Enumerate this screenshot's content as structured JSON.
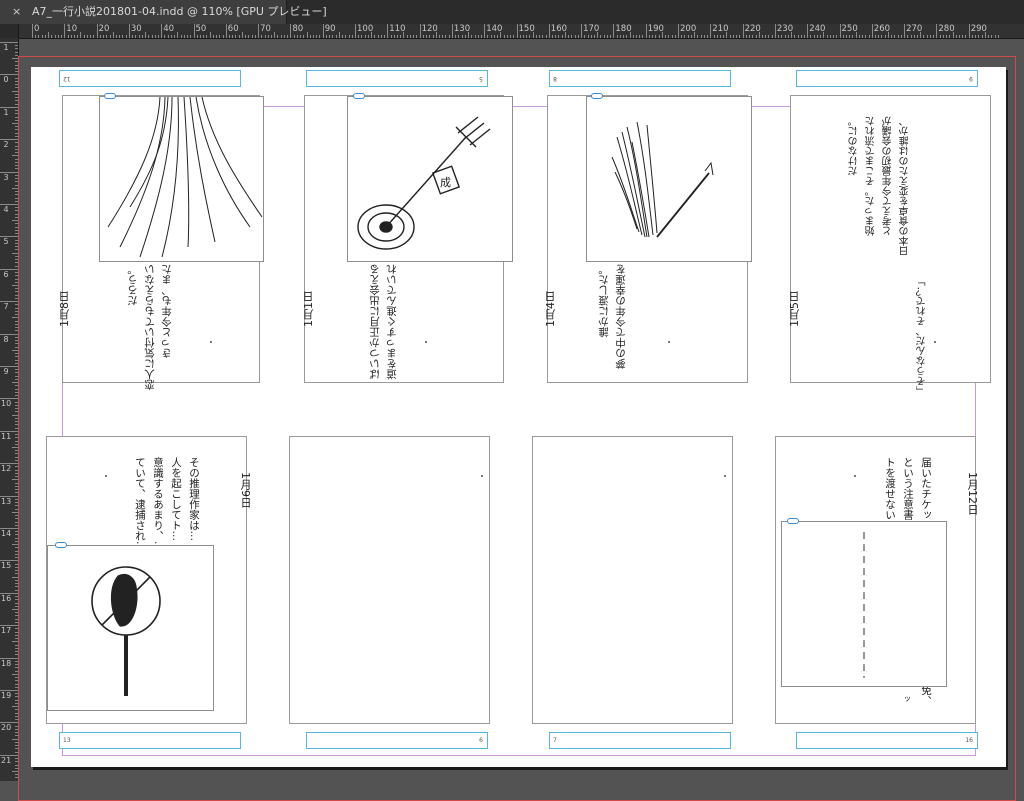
{
  "document_tab": {
    "close_glyph": "×",
    "title": "A7_一行小説201801-04.indd @ 110% [GPU プレビュー]"
  },
  "ruler": {
    "horizontal_labels": [
      "0",
      "10",
      "20",
      "30",
      "40",
      "50",
      "60",
      "70",
      "80",
      "90",
      "100",
      "110",
      "120",
      "130",
      "140",
      "150",
      "160",
      "170",
      "180",
      "190",
      "200",
      "210",
      "220",
      "230",
      "240",
      "250",
      "260",
      "270",
      "280",
      "290"
    ],
    "vertical_labels": [
      "1",
      "0",
      "1",
      "2",
      "3",
      "4",
      "5",
      "6",
      "7",
      "8",
      "9",
      "10",
      "11",
      "12",
      "13",
      "14",
      "15",
      "16",
      "17",
      "18",
      "19",
      "20",
      "21"
    ]
  },
  "top_row": [
    {
      "date_label": "1月8日",
      "page_no": "12",
      "body_lines": [
        "きっと今年も、また",
        "恋人に気付いてもらえない",
        "だろう。"
      ]
    },
    {
      "date_label": "1月1日",
      "page_no": "5",
      "body_lines": [
        "道をまっすぐ進んでいれ",
        "ばいつか正月に出会える"
      ]
    },
    {
      "date_label": "1月4日",
      "page_no": "8",
      "body_lines": [
        "夢の中で今年の幸運を",
        "誰かに渡した。"
      ]
    },
    {
      "date_label": "1月5日",
      "page_no": "9",
      "body_lines": [
        "「そうなんだ、それで？」",
        "日本の食卓を変えたのは誰か、",
        "と考えて今年最初の会議が",
        "始まった。そこまで流れた",
        "だけなのに。"
      ]
    }
  ],
  "bottom_row": [
    {
      "date_label": "1月9日",
      "page_no": "13",
      "body_lines": [
        "その推理作家は…",
        "人を起こしてト…",
        "意識するあまり、…",
        "ていて、逮捕され…"
      ]
    },
    {
      "date_label": "",
      "page_no": "6",
      "body_lines": []
    },
    {
      "date_label": "",
      "page_no": "7",
      "body_lines": []
    },
    {
      "date_label": "1月12日",
      "page_no": "16",
      "body_lines": [
        "届いたチケッ…",
        "という注意書…",
        "トを渡せない…"
      ],
      "tail_text": "免、",
      "tail_text2": "ッ"
    }
  ],
  "illustrations": {
    "hair": "hair-illustration",
    "arrow_target": "arrow-target-illustration",
    "arrow_target_tag": "成",
    "brush": "brush-illustration",
    "sign": "no-sign-illustration"
  }
}
